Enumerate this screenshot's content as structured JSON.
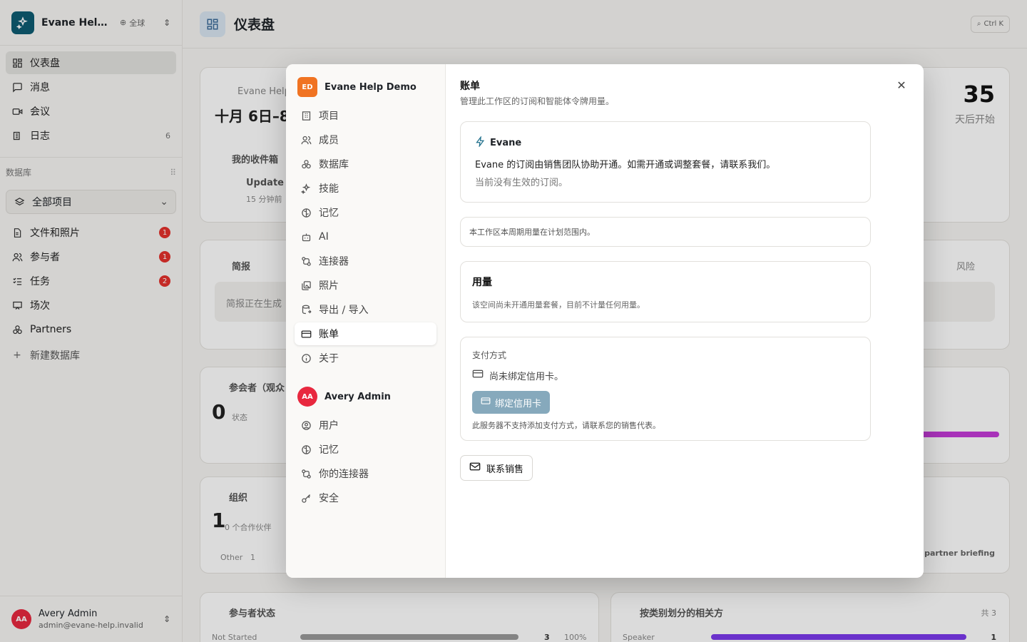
{
  "workspace": {
    "name": "Evane Help Demo",
    "short_name": "Evane Help ...",
    "scope": "全球"
  },
  "sidebar": {
    "items": [
      {
        "label": "仪表盘",
        "icon": "dashboard-icon"
      },
      {
        "label": "消息",
        "icon": "message-icon"
      },
      {
        "label": "会议",
        "icon": "video-icon"
      },
      {
        "label": "日志",
        "icon": "log-icon",
        "count": "6"
      }
    ],
    "section_label": "数据库",
    "db_select": "全部项目",
    "db_items": [
      {
        "label": "文件和照片",
        "badge": "1"
      },
      {
        "label": "参与者",
        "badge": "1"
      },
      {
        "label": "任务",
        "badge": "2"
      },
      {
        "label": "场次"
      },
      {
        "label": "Partners"
      }
    ],
    "new_db": "新建数据库"
  },
  "user": {
    "name": "Avery Admin",
    "email": "admin@evane-help.invalid",
    "initials": "AA"
  },
  "main": {
    "title": "仪表盘",
    "shortcut": "Ctrl K",
    "bg": {
      "event_owner": "Evane Help",
      "event_date": "十月 6日–8",
      "days_num": "35",
      "days_label": "天后开始",
      "inbox": "我的收件箱",
      "update": "Update",
      "update_time": "15 分钟前",
      "brief": "简报",
      "brief_status": "简报正在生成",
      "tab_risk": "风险",
      "attendee": "参会者（观众",
      "attendee_num": "0",
      "attendee_state": "状态",
      "org": "组织",
      "org_num": "1",
      "org_sub": "0 个合作伙伴",
      "org_other": "Other",
      "org_other_val": "1",
      "partner_brief": "e partner briefing",
      "status_title": "参与者状态",
      "status_row": "Not Started",
      "status_val": "3",
      "status_pct": "100%",
      "role_title": "按类别划分的相关方",
      "role_total": "共 3",
      "role_row": "Speaker",
      "role_val": "1"
    }
  },
  "modal": {
    "workspace_badge": "ED",
    "workspace_name": "Evane Help Demo",
    "workspace_items": [
      {
        "label": "项目",
        "icon": "building-icon"
      },
      {
        "label": "成员",
        "icon": "users-icon"
      },
      {
        "label": "数据库",
        "icon": "database-icon"
      },
      {
        "label": "技能",
        "icon": "sparkles-icon"
      },
      {
        "label": "记忆",
        "icon": "brain-icon"
      },
      {
        "label": "AI",
        "icon": "bot-icon"
      },
      {
        "label": "连接器",
        "icon": "connector-icon"
      },
      {
        "label": "照片",
        "icon": "photos-icon"
      },
      {
        "label": "导出 / 导入",
        "icon": "export-import-icon"
      },
      {
        "label": "账单",
        "icon": "credit-card-icon",
        "active": true
      },
      {
        "label": "关于",
        "icon": "info-icon"
      }
    ],
    "user_initials": "AA",
    "user_name": "Avery Admin",
    "user_items": [
      {
        "label": "用户",
        "icon": "user-circle-icon"
      },
      {
        "label": "记忆",
        "icon": "brain-icon"
      },
      {
        "label": "你的连接器",
        "icon": "connector-icon"
      },
      {
        "label": "安全",
        "icon": "key-icon"
      }
    ],
    "content": {
      "title": "账单",
      "description": "管理此工作区的订阅和智能体令牌用量。",
      "plan_name": "Evane",
      "plan_line1": "Evane 的订阅由销售团队协助开通。如需开通或调整套餐，请联系我们。",
      "plan_line2": "当前没有生效的订阅。",
      "notice": "本工作区本周期用量在计划范围内。",
      "usage_title": "用量",
      "usage_text": "该空间尚未开通用量套餐，目前不计量任何用量。",
      "payment_label": "支付方式",
      "payment_status": "尚未绑定信用卡。",
      "bind_button": "绑定信用卡",
      "payment_note": "此服务器不支持添加支付方式，请联系您的销售代表。",
      "contact_button": "联系销售"
    }
  },
  "colors": {
    "accent": "#0f5c73",
    "badge_red": "#e5322d",
    "workspace_orange": "#f07322",
    "bind_button": "#86a9bc",
    "avatar_red": "#e8283f"
  }
}
